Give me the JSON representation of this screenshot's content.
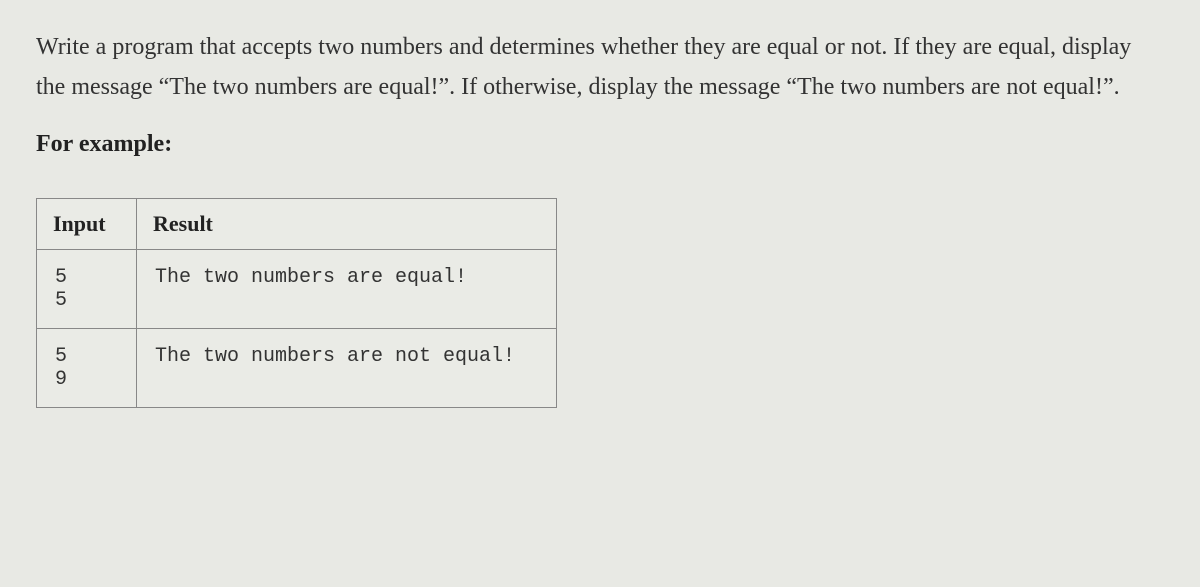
{
  "question": "Write a program that accepts two numbers and determines whether they are equal or not. If they are equal, display the message “The two numbers are equal!”. If otherwise, display the message “The two numbers are not equal!”.",
  "example_label": "For example:",
  "table": {
    "headers": {
      "input": "Input",
      "result": "Result"
    },
    "rows": [
      {
        "input": "5\n5",
        "result": "The two numbers are equal!"
      },
      {
        "input": "5\n9",
        "result": "The two numbers are not equal!"
      }
    ]
  }
}
